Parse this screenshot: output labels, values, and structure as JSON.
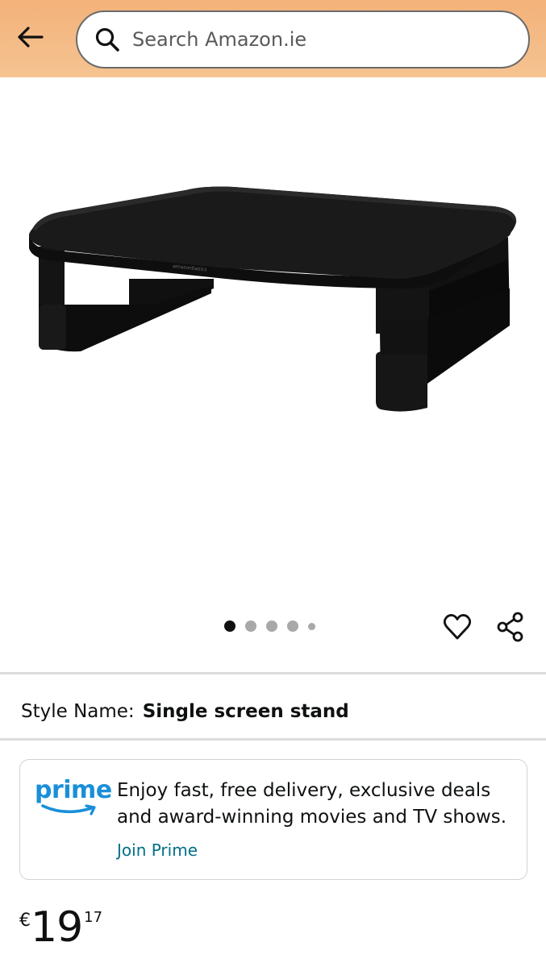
{
  "header": {
    "back_icon": "arrow-left-icon",
    "search": {
      "placeholder": "Search Amazon.ie",
      "value": "",
      "icon": "search-icon"
    },
    "background_color": "#f3b27a"
  },
  "product_image": {
    "description_icon": "monitor-stand-image",
    "brand_mark": "amazonbasics"
  },
  "carousel": {
    "total_dots": 5,
    "active_index": 0
  },
  "actions": {
    "wishlist_icon": "heart-icon",
    "share_icon": "share-icon"
  },
  "style": {
    "label": "Style Name:",
    "value": "Single screen stand"
  },
  "prime": {
    "logo_text": "prime",
    "message": "Enjoy fast, free delivery, exclusive deals and award-winning movies and TV shows.",
    "link_label": "Join Prime",
    "link_color": "#007185",
    "logo_color": "#1a8fd9"
  },
  "price": {
    "symbol": "€",
    "whole": "19",
    "fraction": "17"
  }
}
